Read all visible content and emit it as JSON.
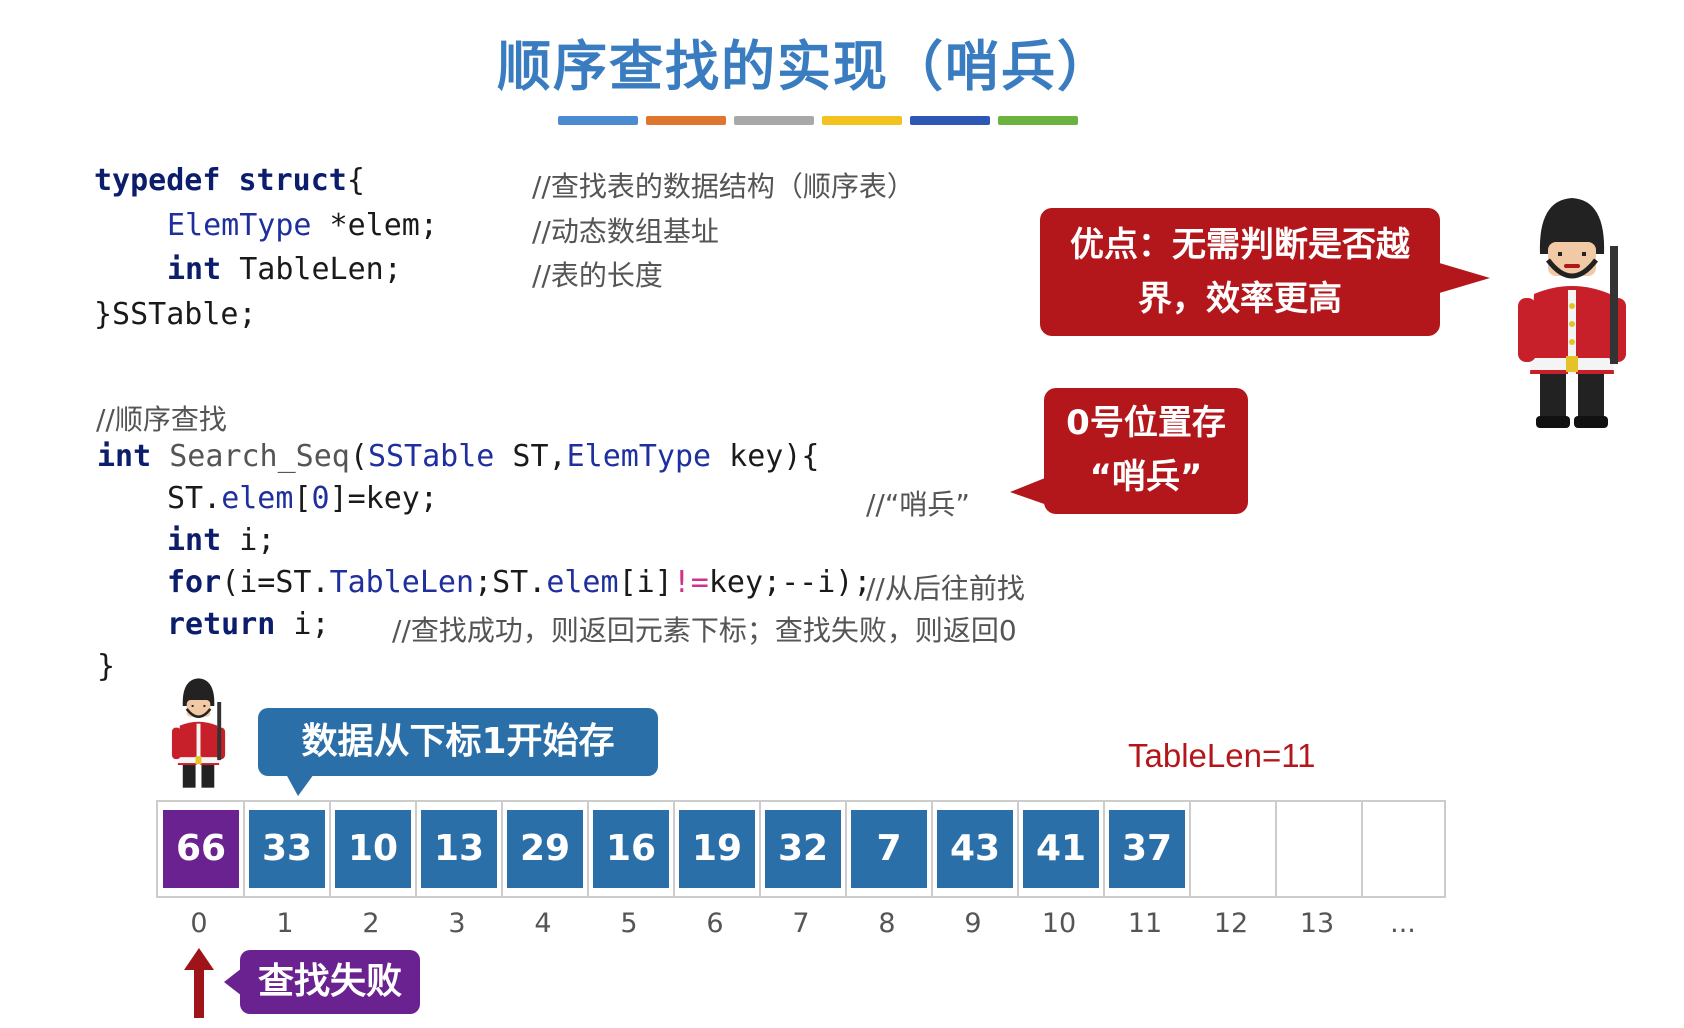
{
  "title": "顺序查找的实现（哨兵）",
  "accent_bar_colors": [
    "#4a8bd1",
    "#e0752d",
    "#a8a8a8",
    "#f3c21e",
    "#2e57b5",
    "#6bb33f"
  ],
  "struct_code": {
    "line1_kw1": "typedef",
    "line1_kw2": "struct",
    "line1_rest": "{",
    "line2_type": "ElemType",
    "line2_rest": " *elem;",
    "line3_type": "int",
    "line3_rest": " TableLen;",
    "line4": "}SSTable;",
    "comment1": "//查找表的数据结构（顺序表）",
    "comment2": "//动态数组基址",
    "comment3": "//表的长度"
  },
  "search_code": {
    "comment_header": "//顺序查找",
    "sig_kw": "int",
    "sig_fn": "Search_Seq",
    "sig_open": "(",
    "sig_t1": "SSTable",
    "sig_p1": " ST,",
    "sig_t2": "ElemType",
    "sig_p2": " key){",
    "l2_a": "ST.",
    "l2_b": "elem",
    "l2_c": "[",
    "l2_d": "0",
    "l2_e": "]=key;",
    "l2_comment": "//“哨兵”",
    "l3_kw": "int",
    "l3_rest": " i;",
    "l4_kw": "for",
    "l4_a": "(i=ST.",
    "l4_b": "TableLen",
    "l4_c": ";ST.",
    "l4_d": "elem",
    "l4_e": "[i]",
    "l4_f": "!=",
    "l4_g": "key;--i); ",
    "l4_comment": "//从后往前找",
    "l5_kw": "return",
    "l5_rest": " i;",
    "l5_comment": "//查找成功，则返回元素下标；查找失败，则返回0",
    "closing": "}"
  },
  "callouts": {
    "advantage_line1": "优点：无需判断是否越",
    "advantage_line2": "界，效率更高",
    "sentinel_line1": "0号位置存",
    "sentinel_line2": "“哨兵”",
    "data_start": "数据从下标1开始存",
    "search_fail": "查找失败"
  },
  "tablelen_label": "TableLen=11",
  "array_values": [
    "66",
    "33",
    "10",
    "13",
    "29",
    "16",
    "19",
    "32",
    "7",
    "43",
    "41",
    "37"
  ],
  "array_indices": [
    "0",
    "1",
    "2",
    "3",
    "4",
    "5",
    "6",
    "7",
    "8",
    "9",
    "10",
    "11",
    "12",
    "13",
    "..."
  ],
  "colors": {
    "sentinel_cell": "#6a2291",
    "data_cell": "#2b6fa8",
    "callout_red": "#b3171c",
    "title_blue": "#3a7cc0",
    "arrow_red": "#9e1419"
  }
}
